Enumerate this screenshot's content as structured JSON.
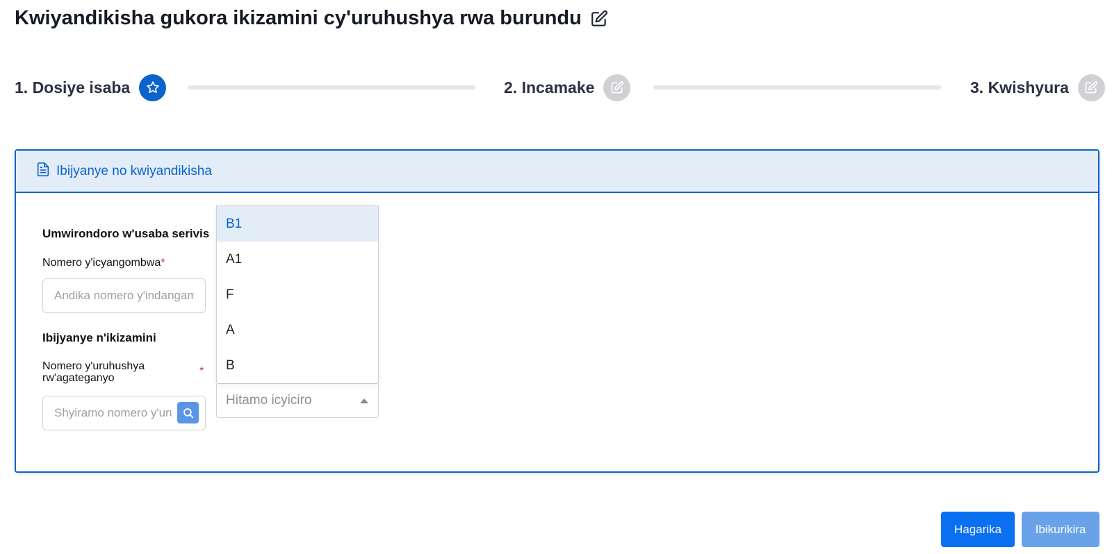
{
  "page": {
    "title": "Kwiyandikisha gukora ikizamini cy'uruhushya rwa burundu"
  },
  "stepper": {
    "steps": [
      {
        "label": "1. Dosiye isaba",
        "icon": "star-icon",
        "state": "active"
      },
      {
        "label": "2. Incamake",
        "icon": "edit-icon",
        "state": "inactive"
      },
      {
        "label": "3. Kwishyura",
        "icon": "edit-icon",
        "state": "inactive"
      }
    ]
  },
  "card": {
    "header_icon": "document-icon",
    "header": "Ibijyanye no kwiyandikisha",
    "applicant_section_title": "Umwirondoro w'usaba serivis",
    "id_label": "Nomero y'icyangombwa",
    "id_placeholder": "Andika nomero y'indangamuntu",
    "exam_section_title": "Ibijyanye n'ikizamini",
    "license_label": "Nomero y'uruhushya rw'agateganyo",
    "license_placeholder": "Shyiramo nomero y'uruhushya",
    "category_placeholder": "Hitamo icyiciro",
    "category_options": [
      "B1",
      "A1",
      "F",
      "A",
      "B"
    ],
    "required_mark": "*"
  },
  "actions": {
    "cancel_label": "Hagarika",
    "next_label": "Ibikurikira"
  },
  "colors": {
    "accent": "#0b63ce",
    "header_bg": "#e2edf8",
    "inactive_step": "#cfd1d4",
    "required": "#e0243b"
  }
}
